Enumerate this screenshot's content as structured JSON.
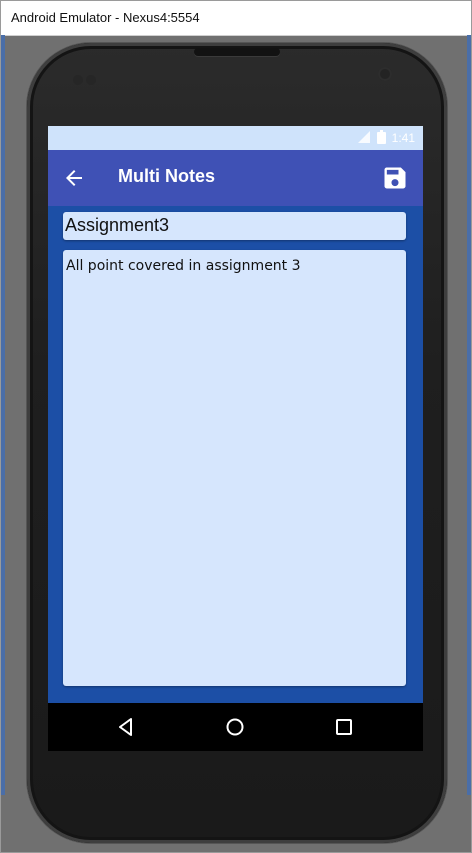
{
  "window": {
    "title": "Android Emulator - Nexus4:5554"
  },
  "status_bar": {
    "time": "1:41",
    "icons": [
      "signal-icon",
      "battery-icon"
    ]
  },
  "app_bar": {
    "title": "Multi Notes",
    "back_icon": "arrow-left-icon",
    "save_icon": "save-icon"
  },
  "note": {
    "title_value": "Assignment3",
    "body_value": "All point covered in assignment 3"
  },
  "nav_bar": {
    "icons": [
      "back-triangle-icon",
      "home-circle-icon",
      "recents-square-icon"
    ]
  },
  "colors": {
    "app_bar": "#3f51b5",
    "screen_background": "#1c4fa6",
    "field_background": "#d6e6fd",
    "status_bar": "#cfe3fb"
  }
}
